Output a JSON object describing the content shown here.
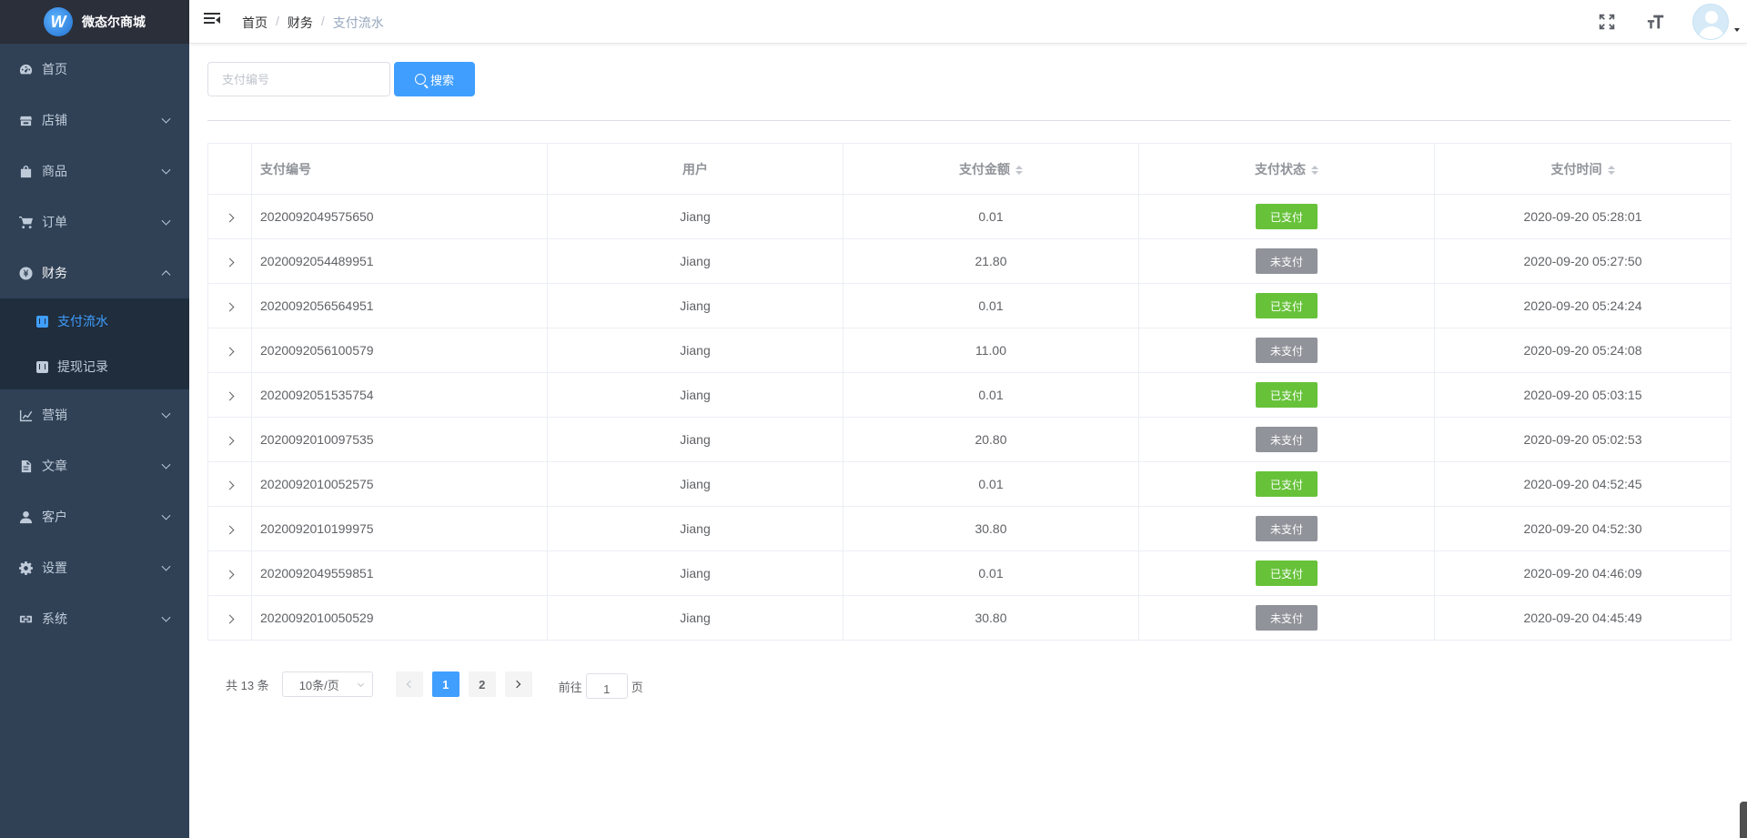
{
  "app": {
    "logo_text": "微态尔商城",
    "logo_glyph": "W"
  },
  "sidebar": {
    "items": [
      {
        "label": "首页",
        "icon": "dashboard-icon",
        "expandable": false
      },
      {
        "label": "店铺",
        "icon": "store-icon",
        "expandable": true
      },
      {
        "label": "商品",
        "icon": "bag-icon",
        "expandable": true
      },
      {
        "label": "订单",
        "icon": "cart-icon",
        "expandable": true
      },
      {
        "label": "财务",
        "icon": "yen-icon",
        "expandable": true,
        "open": true,
        "children": [
          {
            "label": "支付流水",
            "active": true
          },
          {
            "label": "提现记录",
            "active": false
          }
        ]
      },
      {
        "label": "营销",
        "icon": "chart-icon",
        "expandable": true
      },
      {
        "label": "文章",
        "icon": "document-icon",
        "expandable": true
      },
      {
        "label": "客户",
        "icon": "user-icon",
        "expandable": true
      },
      {
        "label": "设置",
        "icon": "gear-icon",
        "expandable": true
      },
      {
        "label": "系统",
        "icon": "link-icon",
        "expandable": true
      }
    ]
  },
  "breadcrumb": [
    "首页",
    "财务",
    "支付流水"
  ],
  "search": {
    "placeholder": "支付编号",
    "value": "",
    "button_label": "搜索"
  },
  "table": {
    "columns": [
      "支付编号",
      "用户",
      "支付金额",
      "支付状态",
      "支付时间"
    ],
    "sortable": [
      false,
      false,
      true,
      true,
      true
    ],
    "rows": [
      {
        "id": "2020092049575650",
        "user": "Jiang",
        "amount": "0.01",
        "status": "已支付",
        "paid": true,
        "time": "2020-09-20 05:28:01"
      },
      {
        "id": "2020092054489951",
        "user": "Jiang",
        "amount": "21.80",
        "status": "未支付",
        "paid": false,
        "time": "2020-09-20 05:27:50"
      },
      {
        "id": "2020092056564951",
        "user": "Jiang",
        "amount": "0.01",
        "status": "已支付",
        "paid": true,
        "time": "2020-09-20 05:24:24"
      },
      {
        "id": "2020092056100579",
        "user": "Jiang",
        "amount": "11.00",
        "status": "未支付",
        "paid": false,
        "time": "2020-09-20 05:24:08"
      },
      {
        "id": "2020092051535754",
        "user": "Jiang",
        "amount": "0.01",
        "status": "已支付",
        "paid": true,
        "time": "2020-09-20 05:03:15"
      },
      {
        "id": "2020092010097535",
        "user": "Jiang",
        "amount": "20.80",
        "status": "未支付",
        "paid": false,
        "time": "2020-09-20 05:02:53"
      },
      {
        "id": "2020092010052575",
        "user": "Jiang",
        "amount": "0.01",
        "status": "已支付",
        "paid": true,
        "time": "2020-09-20 04:52:45"
      },
      {
        "id": "2020092010199975",
        "user": "Jiang",
        "amount": "30.80",
        "status": "未支付",
        "paid": false,
        "time": "2020-09-20 04:52:30"
      },
      {
        "id": "2020092049559851",
        "user": "Jiang",
        "amount": "0.01",
        "status": "已支付",
        "paid": true,
        "time": "2020-09-20 04:46:09"
      },
      {
        "id": "2020092010050529",
        "user": "Jiang",
        "amount": "30.80",
        "status": "未支付",
        "paid": false,
        "time": "2020-09-20 04:45:49"
      }
    ]
  },
  "pagination": {
    "total_text": "共 13 条",
    "page_size": "10条/页",
    "pages": [
      "1",
      "2"
    ],
    "current_page": "1",
    "goto_prefix": "前往",
    "goto_value": "1",
    "goto_suffix": "页"
  },
  "colors": {
    "sidebar_bg": "#304156",
    "accent": "#409eff",
    "paid": "#67c23a",
    "unpaid": "#909399"
  }
}
